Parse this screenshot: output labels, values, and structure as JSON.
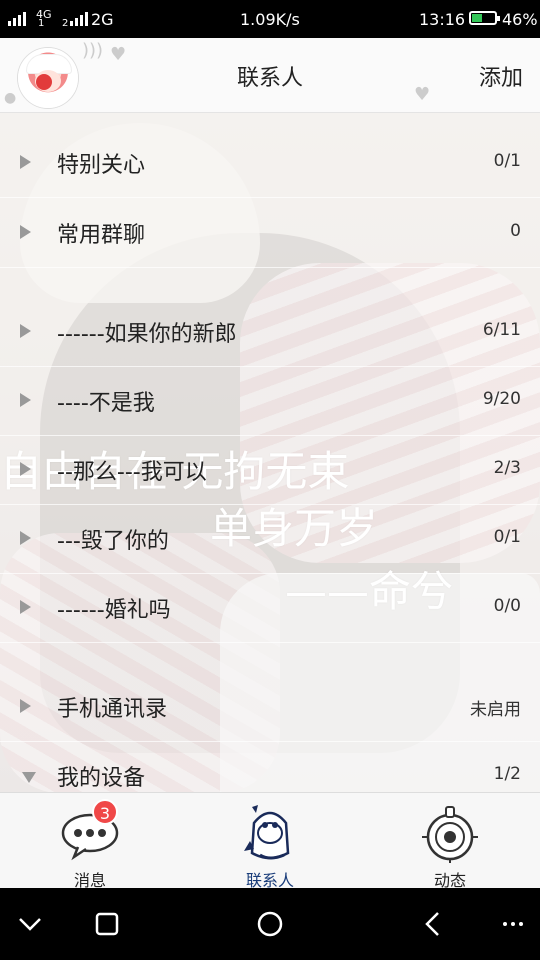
{
  "status_bar": {
    "network1": "4G",
    "sim1": "1",
    "network2": "2G",
    "sim2": "2",
    "speed": "1.09K/s",
    "time": "13:16",
    "battery_percent": "46%",
    "battery_level": 0.46,
    "battery_color": "#34c759"
  },
  "header": {
    "title": "联系人",
    "add_label": "添加"
  },
  "groups": [
    {
      "label": "特别关心",
      "count": "0/1",
      "expanded": false
    },
    {
      "label": "常用群聊",
      "count": "0",
      "expanded": false
    },
    {
      "label": "------如果你的新郎",
      "count": "6/11",
      "expanded": false
    },
    {
      "label": "----不是我",
      "count": "9/20",
      "expanded": false
    },
    {
      "label": "--那么---我可以",
      "count": "2/3",
      "expanded": false
    },
    {
      "label": "---毁了你的",
      "count": "0/1",
      "expanded": false
    },
    {
      "label": "------婚礼吗",
      "count": "0/0",
      "expanded": false
    },
    {
      "label": "手机通讯录",
      "count": "未启用",
      "expanded": false
    },
    {
      "label": "我的设备",
      "count": "1/2",
      "expanded": true
    }
  ],
  "watermark": {
    "line1": "自由自在  无拘无束",
    "line2": "单身万岁",
    "line3": "——命兮"
  },
  "tabs": [
    {
      "label": "消息",
      "badge": "3",
      "icon": "chat-bubble-icon"
    },
    {
      "label": "联系人",
      "icon": "contacts-penguin-icon",
      "active": true
    },
    {
      "label": "动态",
      "icon": "dynamic-star-icon"
    }
  ],
  "nav": {
    "icons": [
      "hide-keyboard-icon",
      "recents-icon",
      "home-icon",
      "back-icon",
      "menu-icon"
    ]
  }
}
